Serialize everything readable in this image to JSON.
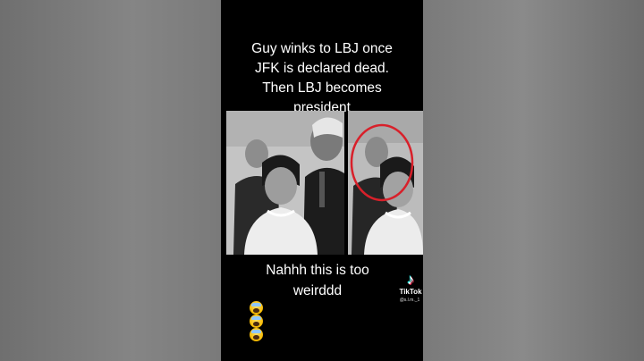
{
  "video": {
    "top_caption": [
      "Guy winks to LBJ once",
      "JFK is declared dead.",
      "Then LBJ becomes",
      "president"
    ],
    "bottom_caption": [
      "Nahhh this is too",
      "weirddd"
    ],
    "emojis": [
      "screaming-face-emoji",
      "screaming-face-emoji",
      "screaming-face-emoji"
    ],
    "watermark": {
      "logo_glyph": "♪",
      "brand": "TikTok",
      "username": "@s.l.m._1"
    },
    "highlight_circle_color": "#d8202a"
  }
}
